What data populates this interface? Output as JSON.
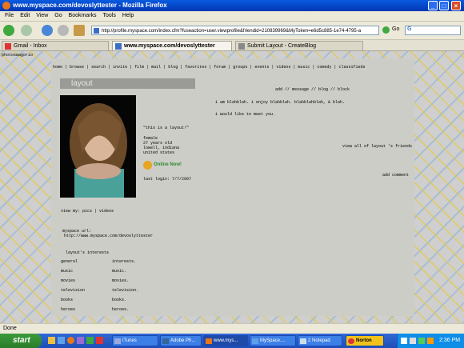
{
  "window": {
    "title": "www.myspace.com/devoslyttester - Mozilla Firefox",
    "btn_min": "_",
    "btn_max": "□",
    "btn_close": "×"
  },
  "menubar": {
    "items": [
      "File",
      "Edit",
      "View",
      "Go",
      "Bookmarks",
      "Tools",
      "Help"
    ]
  },
  "navbar": {
    "url": "http://profile.myspace.com/index.cfm?fuseaction=user.viewprofile&friendid=210839969&MyToken=e6d5c885-1e74-4795-a",
    "go": "Go",
    "search_letter": "G"
  },
  "tabs": [
    {
      "label": "Gmail - Inbox",
      "active": false
    },
    {
      "label": "www.myspace.com/devoslyttester",
      "active": true
    },
    {
      "label": "Submit Layout - CreateBlog",
      "active": false
    }
  ],
  "page": {
    "top_left": "photoswagorio",
    "nav": [
      "home",
      "browse",
      "search",
      "invite",
      "film",
      "mail",
      "blog",
      "favorites",
      "forum",
      "groups",
      "events",
      "videos",
      "music",
      "comedy",
      "classifieds"
    ],
    "header": "layout",
    "quote": "\"this is a layout!\"",
    "details": [
      "female",
      "27 years old",
      "lowell, indiana",
      "united states"
    ],
    "online": "Online Now!",
    "last_login": "last login: 7/7/2007",
    "links_top": "add // message // blog // block",
    "blurb1": "i am blahblah. i enjoy blahblah. blahblahblah, & blah.",
    "blurb2": "i would like to meet you.",
    "view_friends": "view all of layout 's friends",
    "add_comment": "add comment",
    "view_my": "view my: pics | videos",
    "url_label": "myspace url:",
    "url_value": "http://www.myspace.com/devoslyttester",
    "interests_title": "layout's interests",
    "interests": [
      {
        "k": "general",
        "v": "interests."
      },
      {
        "k": "music",
        "v": "music."
      },
      {
        "k": "movies",
        "v": "movies."
      },
      {
        "k": "television",
        "v": "television."
      },
      {
        "k": "books",
        "v": "books."
      },
      {
        "k": "heroes",
        "v": "heroes."
      }
    ]
  },
  "status": "Done",
  "taskbar": {
    "start": "start",
    "items": [
      "iTunes",
      "Adobe Ph...",
      "www.mys...",
      "MySpace....",
      "2 Notepad",
      "Norton"
    ],
    "clock": "2:36 PM"
  }
}
